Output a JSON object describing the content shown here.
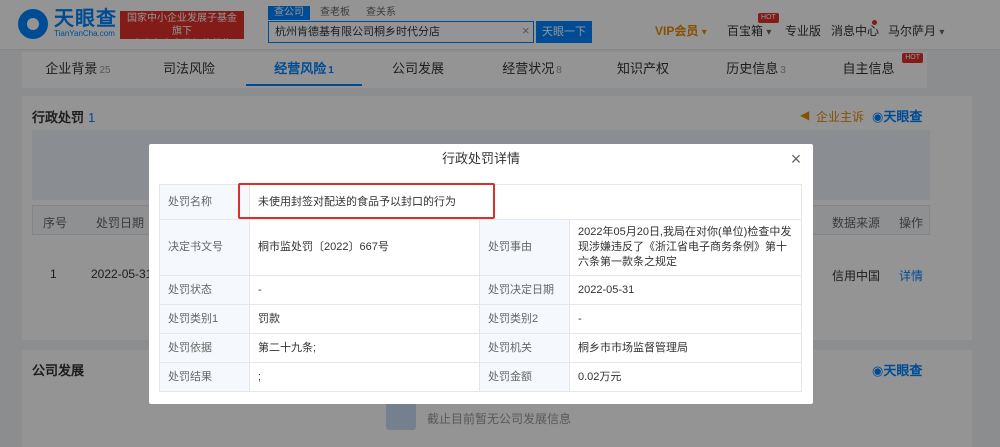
{
  "header": {
    "logo_cn": "天眼查",
    "logo_en": "TianYanCha.com",
    "badge_line1": "国家中小企业发展子基金旗下",
    "badge_line2": "官方备案企业征信机构",
    "search_tabs": [
      "查公司",
      "查老板",
      "查关系"
    ],
    "search_value": "杭州肯德基有限公司桐乡时代分店",
    "search_clear": "×",
    "search_button": "天眼一下",
    "vip": "VIP会员",
    "vip_arrow": "▾",
    "baobaoxiang": "百宝箱",
    "baobaoxiang_arrow": "▾",
    "hot": "HOT",
    "pro": "专业版",
    "messages": "消息中心",
    "user": "马尔萨月",
    "user_arrow": "▾"
  },
  "tabs": [
    {
      "label": "企业背景",
      "count": "25"
    },
    {
      "label": "司法风险",
      "count": ""
    },
    {
      "label": "经营风险",
      "count": "1"
    },
    {
      "label": "公司发展",
      "count": ""
    },
    {
      "label": "经营状况",
      "count": "8"
    },
    {
      "label": "知识产权",
      "count": ""
    },
    {
      "label": "历史信息",
      "count": "3"
    },
    {
      "label": "自主信息",
      "count": ""
    }
  ],
  "tab_hot": "HOT",
  "section1": {
    "title": "行政处罚",
    "count": "1",
    "company_label": "企业主诉",
    "brand": "天眼查",
    "columns": {
      "index": "序号",
      "date": "处罚日期",
      "source": "数据来源",
      "action": "操作"
    },
    "row": {
      "index": "1",
      "date": "2022-05-31",
      "source": "信用中国",
      "action": "详情"
    }
  },
  "section2": {
    "title": "公司发展",
    "brand": "天眼查",
    "empty": "截止目前暂无公司发展信息"
  },
  "modal": {
    "title": "行政处罚详情",
    "close": "×",
    "rows": {
      "name_label": "处罚名称",
      "name_value": "未使用封签对配送的食品予以封口的行为",
      "doc_label": "决定书文号",
      "doc_value": "桐市监处罚〔2022〕667号",
      "reason_label": "处罚事由",
      "reason_value": "2022年05月20日,我局在对你(单位)检查中发现涉嫌违反了《浙江省电子商务条例》第十六条第一款条之规定",
      "status_label": "处罚状态",
      "status_value": "-",
      "decision_date_label": "处罚决定日期",
      "decision_date_value": "2022-05-31",
      "type1_label": "处罚类别1",
      "type1_value": "罚款",
      "type2_label": "处罚类别2",
      "type2_value": "-",
      "basis_label": "处罚依据",
      "basis_value": "第二十九条;",
      "authority_label": "处罚机关",
      "authority_value": "桐乡市市场监督管理局",
      "result_label": "处罚结果",
      "result_value": ";",
      "amount_label": "处罚金额",
      "amount_value": "0.02万元"
    }
  },
  "colors": {
    "brand": "#0084ff",
    "highlight": "#d9302b",
    "vip": "#e58a00"
  }
}
